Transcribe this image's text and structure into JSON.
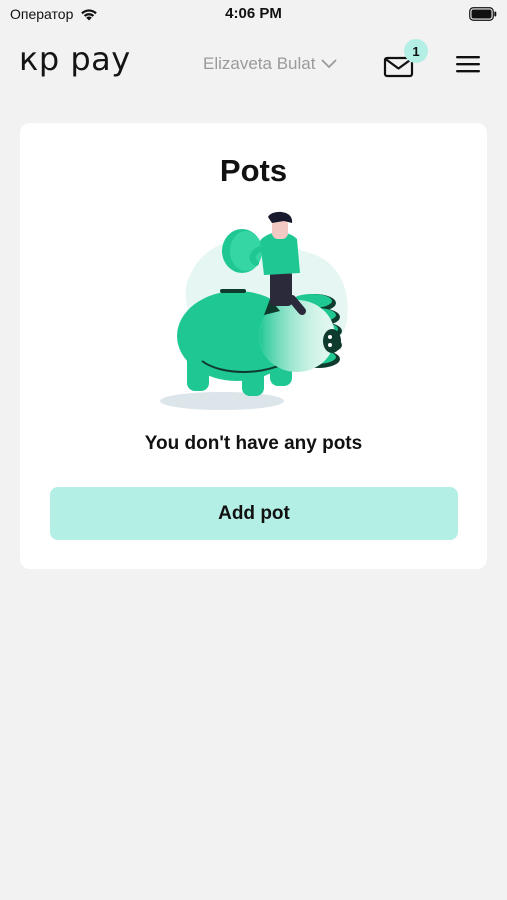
{
  "status_bar": {
    "carrier": "Оператор",
    "time": "4:06 PM"
  },
  "header": {
    "logo": "кр рау",
    "account_name": "Elizaveta Bulat",
    "unread_count": "1"
  },
  "pots": {
    "title": "Pots",
    "empty_message": "You don't have any pots",
    "add_button": "Add pot"
  },
  "colors": {
    "accent": "#b4efe5",
    "illustration_green": "#1fc793",
    "background": "#f2f2f2"
  }
}
